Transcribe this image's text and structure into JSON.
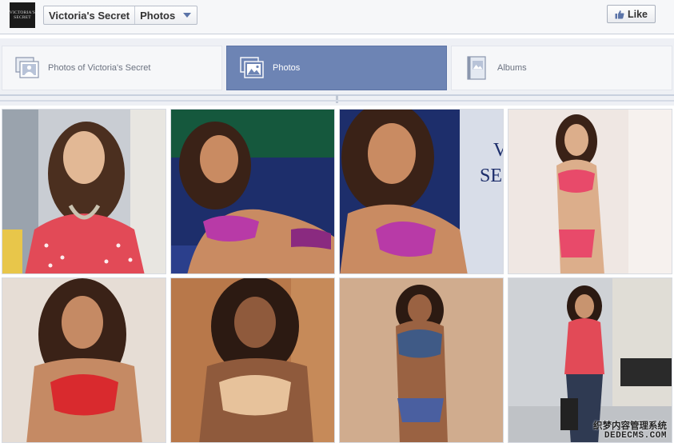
{
  "header": {
    "logo_text": "VICTORIA'S SECRET",
    "page_name": "Victoria's Secret",
    "section": "Photos",
    "like_label": "Like"
  },
  "tabs": [
    {
      "label": "Photos of Victoria's Secret",
      "icon": "photo-of-person-icon",
      "active": false
    },
    {
      "label": "Photos",
      "icon": "photos-icon",
      "active": true
    },
    {
      "label": "Albums",
      "icon": "album-icon",
      "active": false
    }
  ],
  "watermark": {
    "line1": "织梦内容管理系统",
    "line2": "DEDECMS.COM"
  },
  "colors": {
    "active_tab": "#6d84b4",
    "header_bg": "#f6f7f9"
  },
  "photos": [
    {
      "icon": "photo-thumbnail"
    },
    {
      "icon": "photo-thumbnail"
    },
    {
      "icon": "photo-thumbnail"
    },
    {
      "icon": "photo-thumbnail"
    },
    {
      "icon": "photo-thumbnail"
    },
    {
      "icon": "photo-thumbnail"
    },
    {
      "icon": "photo-thumbnail"
    },
    {
      "icon": "photo-thumbnail"
    }
  ]
}
